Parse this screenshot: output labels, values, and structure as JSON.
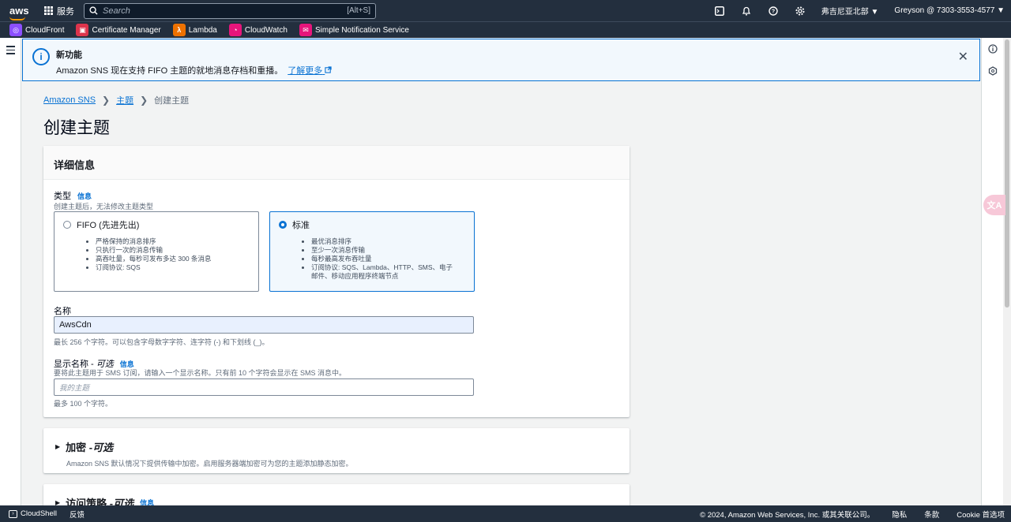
{
  "topnav": {
    "logo": "aws",
    "services_label": "服务",
    "search_placeholder": "Search",
    "search_shortcut": "[Alt+S]",
    "region": "弗吉尼亚北部 ▼",
    "account": "Greyson @ 7303-3553-4577 ▼",
    "icons": [
      "cloudshell-icon",
      "bell-icon",
      "help-icon",
      "gear-icon"
    ]
  },
  "favorites": [
    {
      "label": "CloudFront",
      "color": "#8c4fff"
    },
    {
      "label": "Certificate Manager",
      "color": "#dd344c"
    },
    {
      "label": "Lambda",
      "color": "#ed7100"
    },
    {
      "label": "CloudWatch",
      "color": "#e7157b"
    },
    {
      "label": "Simple Notification Service",
      "color": "#e7157b"
    }
  ],
  "flash": {
    "title": "新功能",
    "body": "Amazon SNS 现在支持 FIFO 主题的就地消息存档和重播。",
    "link": "了解更多"
  },
  "breadcrumb": {
    "item1": "Amazon SNS",
    "item2": "主题",
    "current": "创建主题"
  },
  "page_title": "创建主题",
  "details": {
    "header": "详细信息",
    "type_label": "类型",
    "info": "信息",
    "type_hint": "创建主题后，无法修改主题类型",
    "fifo": {
      "label": "FIFO (先进先出)",
      "bullets": [
        "严格保持的消息排序",
        "只执行一次的消息传输",
        "高吞吐量，每秒可发布多达 300 条消息",
        "订阅协议: SQS"
      ]
    },
    "standard": {
      "label": "标准",
      "bullets": [
        "最优消息排序",
        "至少一次消息传输",
        "每秒最高发布吞吐量",
        "订阅协议: SQS、Lambda、HTTP、SMS、电子邮件、移动应用程序终端节点"
      ]
    },
    "name_label": "名称",
    "name_value": "AwsCdn",
    "name_hint": "最长 256 个字符。可以包含字母数字字符、连字符 (-) 和下划线 (_)。",
    "display_label": "显示名称 - ",
    "display_optional": "可选",
    "display_hint": "要将此主题用于 SMS 订阅，请输入一个显示名称。只有前 10 个字符会显示在 SMS 消息中。",
    "display_placeholder": "我的主题",
    "display_max": "最多 100 个字符。"
  },
  "encryption": {
    "title": "加密 - ",
    "optional": "可选",
    "desc": "Amazon SNS 默认情况下提供传输中加密。启用服务器端加密可为您的主题添加静态加密。"
  },
  "access_policy": {
    "title": "访问策略 - ",
    "optional": "可选",
    "info": "信息"
  },
  "footer": {
    "cloudshell": "CloudShell",
    "feedback": "反馈",
    "copyright": "© 2024, Amazon Web Services, Inc. 或其关联公司。",
    "privacy": "隐私",
    "terms": "条款",
    "cookies": "Cookie 首选项"
  }
}
